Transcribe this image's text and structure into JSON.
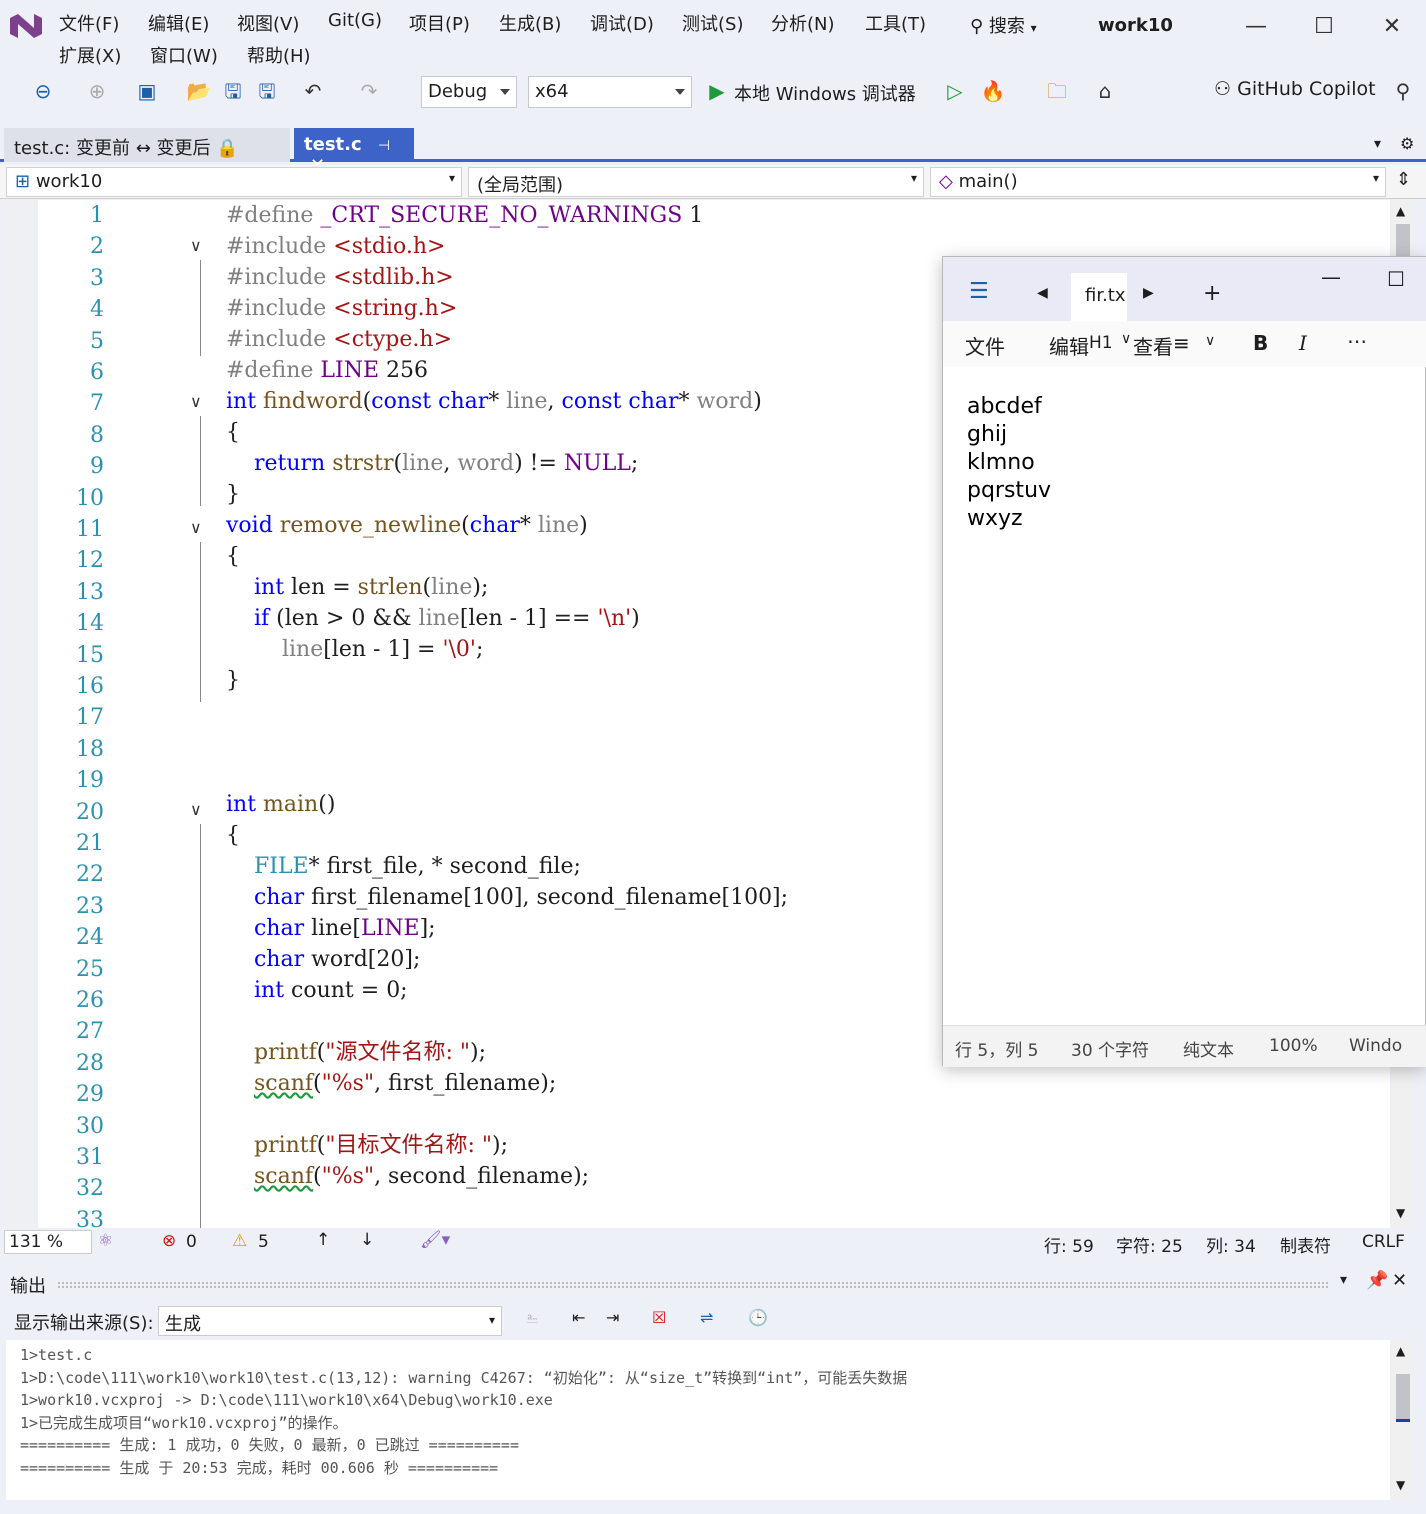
{
  "menu": {
    "row1": [
      "文件(F)",
      "编辑(E)",
      "视图(V)",
      "Git(G)",
      "项目(P)",
      "生成(B)",
      "调试(D)",
      "测试(S)",
      "分析(N)",
      "工具(T)"
    ],
    "row2": [
      "扩展(X)",
      "窗口(W)",
      "帮助(H)"
    ],
    "search": "搜索",
    "project_name": "work10"
  },
  "toolbar": {
    "config": "Debug",
    "platform": "x64",
    "run_label": "本地 Windows 调试器",
    "copilot": "GitHub Copilot"
  },
  "tabs": {
    "diff": "test.c: 变更前 ↔ 变更后",
    "active": "test.c"
  },
  "navbar": {
    "project": "work10",
    "scope": "(全局范围)",
    "member": "main()"
  },
  "editor": {
    "line_numbers": [
      "1",
      "2",
      "3",
      "4",
      "5",
      "6",
      "7",
      "8",
      "9",
      "10",
      "11",
      "12",
      "13",
      "14",
      "15",
      "16",
      "17",
      "18",
      "19",
      "20",
      "21",
      "22",
      "23",
      "24",
      "25",
      "26",
      "27",
      "28",
      "29",
      "30",
      "31",
      "32",
      "33"
    ]
  },
  "status": {
    "zoom": "131 %",
    "errors": "0",
    "warnings": "5",
    "line": "行: 59",
    "chars": "字符: 25",
    "col": "列: 34",
    "tabs": "制表符",
    "eol": "CRLF"
  },
  "output": {
    "title": "输出",
    "source_label": "显示输出来源(S):",
    "source_value": "生成",
    "lines": [
      "1>test.c",
      "1>D:\\code\\111\\work10\\work10\\test.c(13,12): warning C4267: “初始化”: 从“size_t”转换到“int”，可能丢失数据",
      "1>work10.vcxproj -> D:\\code\\111\\work10\\x64\\Debug\\work10.exe",
      "1>已完成生成项目“work10.vcxproj”的操作。",
      "========== 生成: 1 成功，0 失败，0 最新，0 已跳过 ==========",
      "========== 生成 于 20:53 完成，耗时 00.606 秒 =========="
    ]
  },
  "notepad": {
    "tab_title": "fir.tx",
    "menu": [
      "文件",
      "编辑",
      "查看"
    ],
    "heading_mark": "H1",
    "content": [
      "abcdef",
      "ghij",
      "klmno",
      "pqrstuv",
      "wxyz"
    ],
    "status": [
      "行 5，列 5",
      "30 个字符",
      "纯文本",
      "100%",
      "Windo"
    ]
  }
}
